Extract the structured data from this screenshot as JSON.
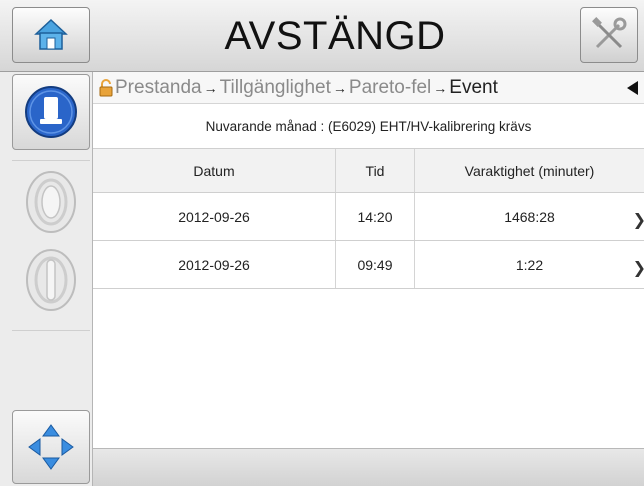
{
  "header": {
    "title": "AVSTÄNGD",
    "home_icon": "home-icon",
    "tools_icon": "tools-icon"
  },
  "breadcrumb": {
    "items": [
      "Prestanda",
      "Tillgänglighet",
      "Pareto-fel"
    ],
    "current": "Event",
    "separator": "→"
  },
  "subtitle": "Nuvarande månad : (E6029) EHT/HV-kalibrering krävs",
  "table": {
    "headers": [
      "Datum",
      "Tid",
      "Varaktighet (minuter)"
    ],
    "rows": [
      {
        "date": "2012-09-26",
        "time": "14:20",
        "duration": "1468:28"
      },
      {
        "date": "2012-09-26",
        "time": "09:49",
        "duration": "1:22"
      }
    ]
  },
  "colors": {
    "accent_blue": "#1f5fbf",
    "lock_orange": "#e8a33a"
  }
}
